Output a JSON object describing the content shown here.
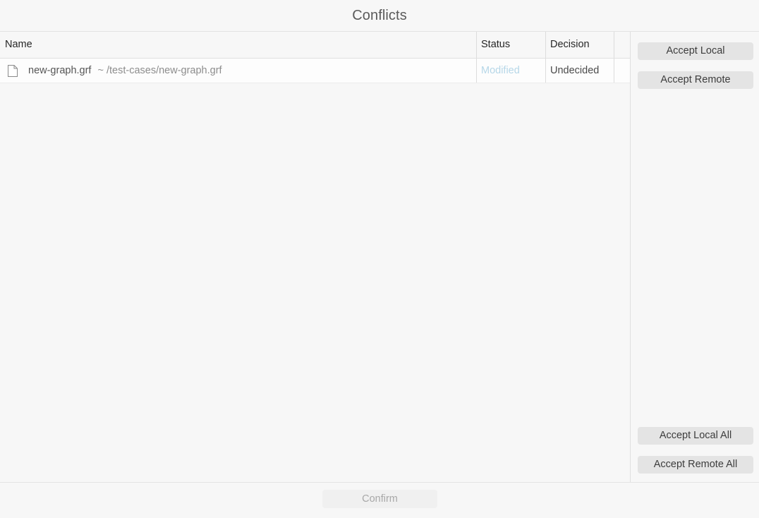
{
  "dialog": {
    "title": "Conflicts"
  },
  "table": {
    "columns": [
      {
        "key": "name",
        "label": "Name"
      },
      {
        "key": "status",
        "label": "Status"
      },
      {
        "key": "decision",
        "label": "Decision"
      }
    ],
    "rows": [
      {
        "icon": "file-document-icon",
        "file_name": "new-graph.grf",
        "file_path": "~ /test-cases/new-graph.grf",
        "status": "Modified",
        "decision": "Undecided"
      }
    ]
  },
  "actions": {
    "accept_local": "Accept Local",
    "accept_remote": "Accept Remote",
    "accept_local_all": "Accept Local All",
    "accept_remote_all": "Accept Remote All"
  },
  "footer": {
    "confirm": "Confirm",
    "confirm_enabled": false
  },
  "colors": {
    "background": "#f7f7f7",
    "row_background": "#fdfdfd",
    "status_modified": "#b6d7e8",
    "button_background": "#e4e4e4",
    "button_disabled_background": "#f0f0f0",
    "button_disabled_text": "#a8a8a8",
    "title_text": "#5a5a5a",
    "header_text": "#262626",
    "divider": "#e3e3e3"
  }
}
